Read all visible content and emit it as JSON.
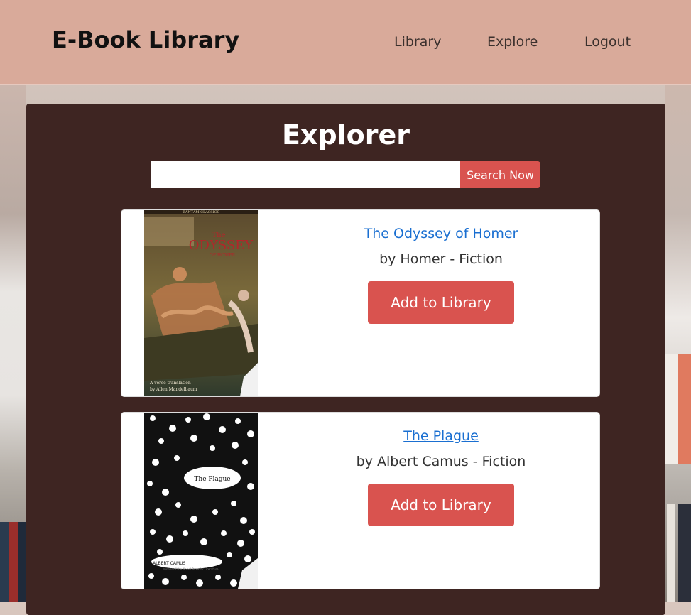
{
  "header": {
    "brand": "E-Book Library",
    "nav": [
      "Library",
      "Explore",
      "Logout"
    ]
  },
  "explorer": {
    "title": "Explorer",
    "search": {
      "value": "",
      "placeholder": "",
      "button_label": "Search Now"
    }
  },
  "books": [
    {
      "title": "The Odyssey of Homer",
      "meta": "by Homer - Fiction",
      "action_label": "Add to Library",
      "cover": {
        "top_text": "BANTAM CLASSICS",
        "title_line1": "The",
        "title_line2": "ODYSSEY",
        "title_line3": "OF HOMER",
        "bottom_line1": "A verse translation",
        "bottom_line2": "by Allen Mandelbaum"
      }
    },
    {
      "title": "The Plague",
      "meta": "by Albert Camus - Fiction",
      "action_label": "Add to Library",
      "cover": {
        "title": "The Plague",
        "author": "ALBERT CAMUS",
        "subline": "Winner of the Nobel Prize for Literature"
      }
    }
  ],
  "colors": {
    "header_bg": "#d9aa9a",
    "panel_bg": "#3e2522",
    "accent": "#d9534f",
    "link": "#1a6fd1"
  }
}
